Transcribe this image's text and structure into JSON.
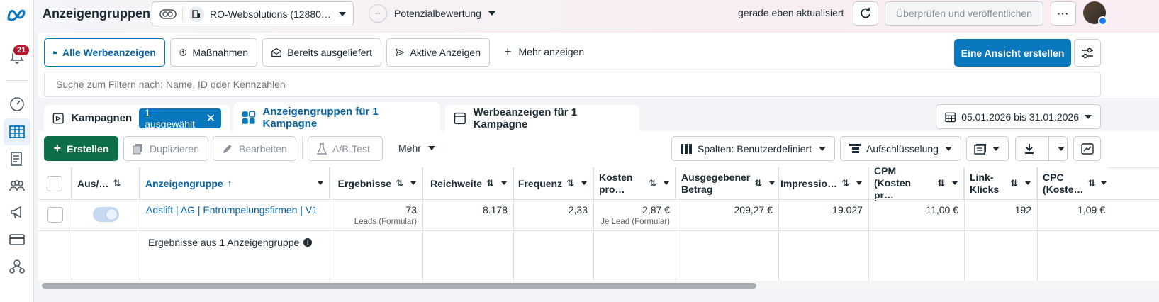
{
  "header": {
    "title": "Anzeigengruppen",
    "account": "RO-Websolutions (12880…",
    "filter_mode": "Potenzialbewertung",
    "filter_mode_prefix": "--",
    "updated": "gerade eben aktualisiert",
    "publish": "Überprüfen und veröffentlichen"
  },
  "rail": {
    "notifications": "21"
  },
  "views": {
    "items": [
      "Alle Werbeanzeigen",
      "Maßnahmen",
      "Bereits ausgeliefert",
      "Aktive Anzeigen"
    ],
    "more": "Mehr anzeigen",
    "create_view": "Eine Ansicht erstellen"
  },
  "search": {
    "placeholder": "Suche zum Filtern nach: Name, ID oder Kennzahlen"
  },
  "tabs": {
    "campaigns": "Kampagnen",
    "selected": "1 ausgewählt",
    "adsets": "Anzeigengruppen für 1 Kampagne",
    "ads": "Werbeanzeigen für 1 Kampagne",
    "date_range": "05.01.2026 bis 31.01.2026"
  },
  "toolbar": {
    "create": "Erstellen",
    "duplicate": "Duplizieren",
    "edit": "Bearbeiten",
    "abtest": "A/B-Test",
    "more": "Mehr",
    "columns": "Spalten: Benutzerdefiniert",
    "breakdown": "Aufschlüsselung"
  },
  "table": {
    "headers": {
      "status": "Aus/…",
      "name": "Anzeigengruppe",
      "results": "Ergebnisse",
      "reach": "Reichweite",
      "frequency": "Frequenz",
      "cost_a": "Kosten",
      "cost_b": "pro…",
      "spent_a": "Ausgegebener",
      "spent_b": "Betrag",
      "impressions": "Impressio…",
      "cpm_a": "CPM",
      "cpm_b": "(Kosten pr…",
      "clicks_a": "Link-",
      "clicks_b": "Klicks",
      "cpc_a": "CPC",
      "cpc_b": "(Koste…"
    },
    "row": {
      "name": "Adslift | AG | Entrümpelungsfirmen | V1",
      "results": "73",
      "results_sub": "Leads (Formular)",
      "reach": "8.178",
      "frequency": "2,33",
      "cost": "2,87 €",
      "cost_sub": "Je Lead (Formular)",
      "spent": "209,27 €",
      "impressions": "19.027",
      "cpm": "11,00 €",
      "clicks": "192",
      "cpc": "1,09 €"
    },
    "summary": "Ergebnisse aus 1 Anzeigengruppe"
  }
}
